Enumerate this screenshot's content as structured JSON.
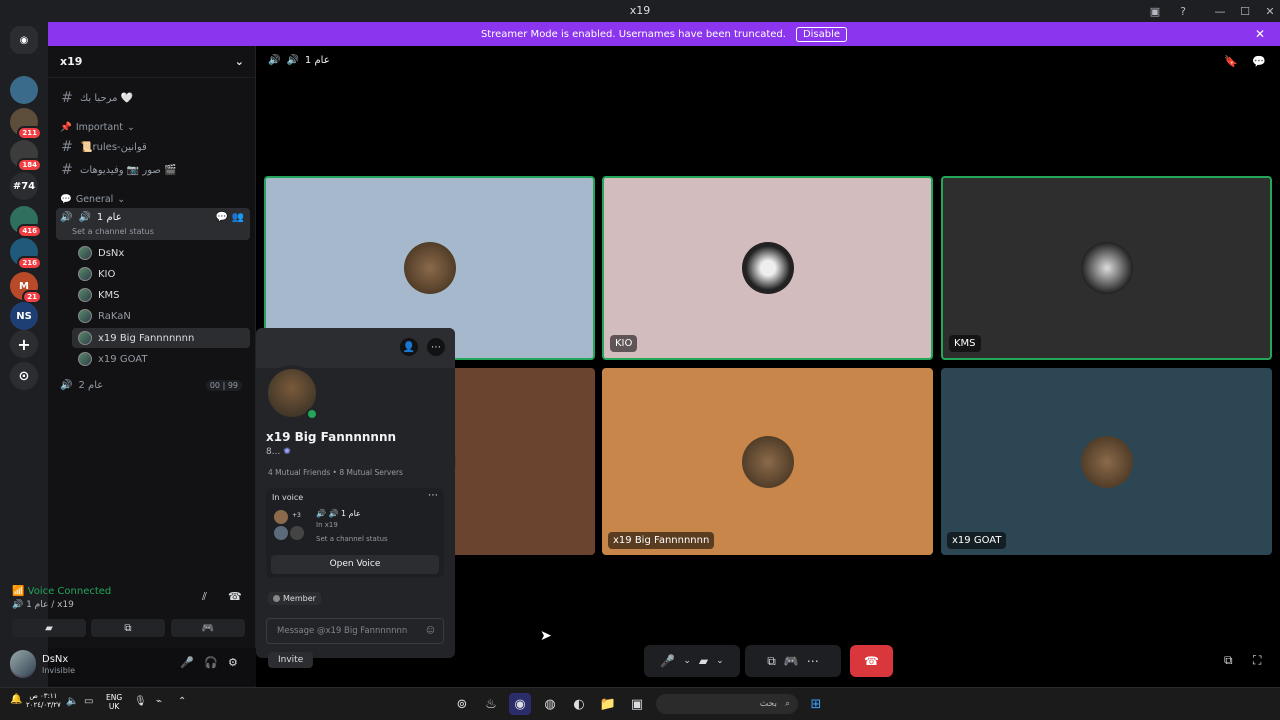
{
  "window": {
    "title": "x19"
  },
  "banner": {
    "text": "Streamer Mode is enabled. Usernames have been truncated.",
    "disable_label": "Disable"
  },
  "servers": [
    {
      "label": "",
      "color": "#3a6b8a",
      "badge": ""
    },
    {
      "label": "",
      "color": "#5d4d3b",
      "badge": "211"
    },
    {
      "label": "",
      "color": "#3c3c3c",
      "badge": "184"
    },
    {
      "label": "#74",
      "color": "#2b2d31",
      "badge": ""
    },
    {
      "label": "",
      "color": "#2f6f5e",
      "badge": "416"
    },
    {
      "label": "",
      "color": "#1f5a7a",
      "badge": "216"
    },
    {
      "label": "M",
      "color": "#b84a2a",
      "badge": "21"
    },
    {
      "label": "NS",
      "color": "#1d3f73",
      "badge": ""
    }
  ],
  "guild": {
    "name": "x19"
  },
  "channels": {
    "welcome": "مرحبا بك 🤍",
    "cat_important": "Important",
    "rules": "📜rules-قوانين",
    "media": "صور 📷 وفيديوهات 🎬",
    "cat_general": "General",
    "voice1": "عام 1",
    "voice1_status": "Set a channel status",
    "voice2": "عام 2",
    "voice2_count_a": "00",
    "voice2_count_b": "99"
  },
  "voice_users": [
    "DsNx",
    "KIO",
    "KMS",
    "RaKaN",
    "x19 Big Fannnnnnn",
    "x19 GOAT"
  ],
  "voice_panel": {
    "status": "Voice Connected",
    "location": "عام 1 / x19"
  },
  "user": {
    "name": "DsNx",
    "status": "Invisible"
  },
  "stage": {
    "channel": "عام 1"
  },
  "tiles": [
    {
      "name": "",
      "bg": "#a6b8cc"
    },
    {
      "name": "KIO",
      "bg": "#d2bcbe"
    },
    {
      "name": "KMS",
      "bg": "#2e2e2e"
    },
    {
      "name": "",
      "bg": "#6b4430"
    },
    {
      "name": "x19 Big Fannnnnnn",
      "bg": "#c8864a"
    },
    {
      "name": "x19 GOAT",
      "bg": "#2c4653"
    }
  ],
  "popup": {
    "name": "x19 Big Fannnnnnn",
    "tag": "8...",
    "mutual_friends": "4 Mutual Friends",
    "mutual_servers": "8 Mutual Servers",
    "in_voice_label": "In voice",
    "channel": "عام 1",
    "server": "In x19",
    "channel_status": "Set a channel status",
    "extra_count": "+3",
    "open_voice": "Open Voice",
    "role": "Member",
    "message_placeholder": "Message @x19 Big Fannnnnnn"
  },
  "invite_label": "Invite",
  "taskbar": {
    "time": "٠٣:١١ ص",
    "date": "٢٠٢٤/٠٣/٢٧",
    "lang": "ENG",
    "region": "UK",
    "search_placeholder": "بحث"
  }
}
